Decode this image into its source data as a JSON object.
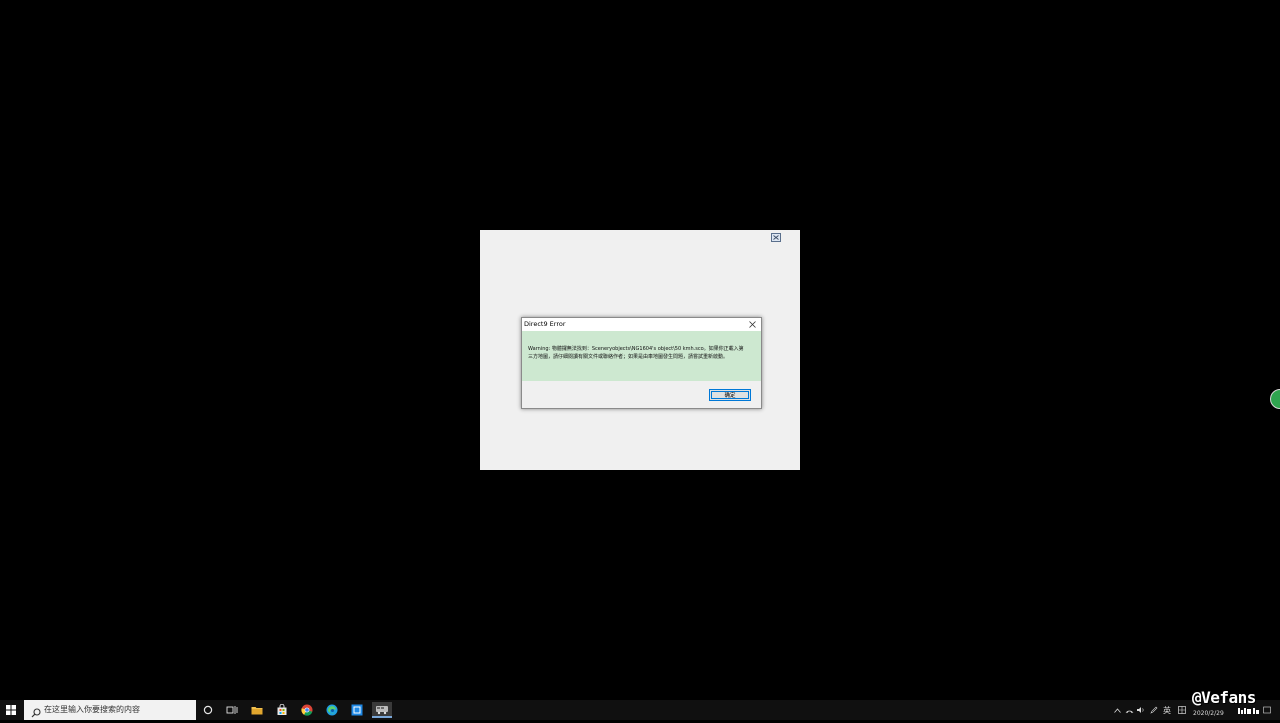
{
  "dialog": {
    "title": "Direct9 Error",
    "message": "Warning: 物體攞無法找到：Sceneryobjects\\NG1604's object\\50 kmh.sco。如果你正載入第三方地圖，請仔細閱讀有關文件或聯絡作者；如果是由車地圖發生問題，請嘗試重新啟動。",
    "ok_label": "确定"
  },
  "taskbar": {
    "search_placeholder": "在这里输入你要搜索的内容",
    "ime_label": "英",
    "date": "2020/2/29"
  },
  "watermark": {
    "text": "@Vefans"
  },
  "colors": {
    "dialog_body": "#cde8d0",
    "accent": "#0078d7",
    "desktop": "#000000",
    "taskbar": "#101010"
  }
}
